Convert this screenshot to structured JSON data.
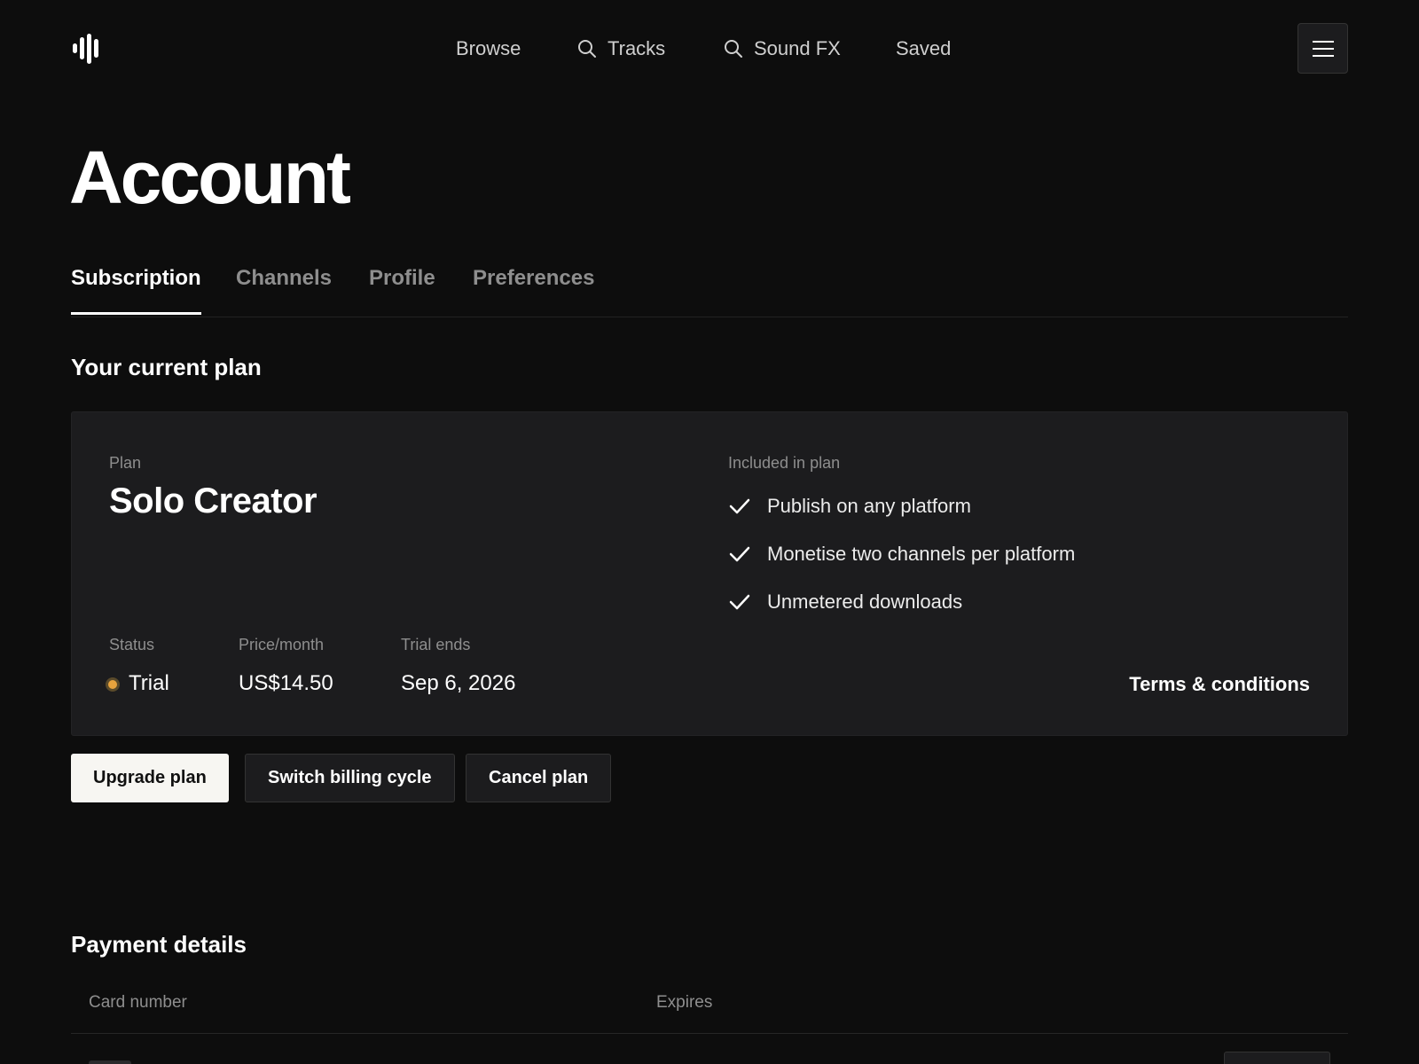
{
  "nav": {
    "items": [
      {
        "label": "Browse",
        "icon": ""
      },
      {
        "label": "Tracks",
        "icon": "search-icon"
      },
      {
        "label": "Sound FX",
        "icon": "search-icon"
      },
      {
        "label": "Saved",
        "icon": ""
      }
    ],
    "menu_icon": "hamburger-menu-icon"
  },
  "page": {
    "title": "Account"
  },
  "tabs": [
    {
      "label": "Subscription",
      "active": true
    },
    {
      "label": "Channels",
      "active": false
    },
    {
      "label": "Profile",
      "active": false
    },
    {
      "label": "Preferences",
      "active": false
    }
  ],
  "current_plan": {
    "section_title": "Your current plan",
    "plan_label": "Plan",
    "plan_name": "Solo Creator",
    "included_label": "Included in plan",
    "features": [
      "Publish on any platform",
      "Monetise two channels per platform",
      "Unmetered downloads"
    ],
    "status_label": "Status",
    "status_value": "Trial",
    "status_color": "#e8a33d",
    "price_label": "Price/month",
    "price_value": "US$14.50",
    "trial_label": "Trial ends",
    "trial_value": "Sep 6, 2026",
    "terms_link": "Terms & conditions"
  },
  "actions": {
    "upgrade": "Upgrade plan",
    "switch_cycle": "Switch billing cycle",
    "cancel": "Cancel plan"
  },
  "payment": {
    "section_title": "Payment details",
    "columns": [
      "Card number",
      "Expires"
    ]
  }
}
